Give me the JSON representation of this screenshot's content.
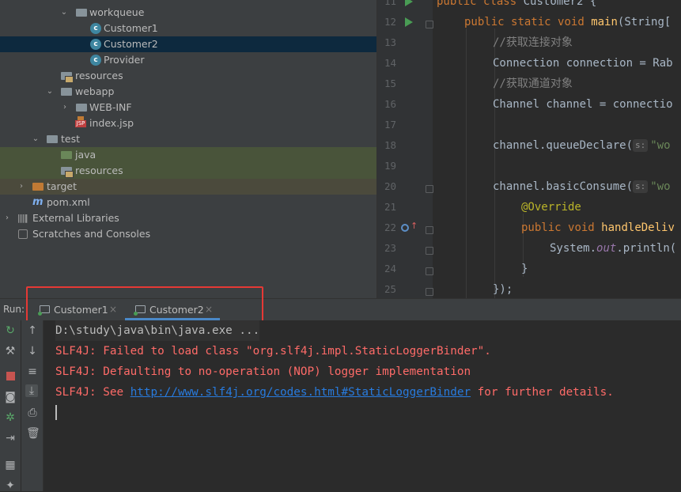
{
  "tree": {
    "items": [
      {
        "label": "workqueue",
        "kind": "package",
        "arrow": "open"
      },
      {
        "label": "Customer1",
        "kind": "class"
      },
      {
        "label": "Customer2",
        "kind": "class",
        "selected": true
      },
      {
        "label": "Provider",
        "kind": "class"
      },
      {
        "label": "resources",
        "kind": "resources"
      },
      {
        "label": "webapp",
        "kind": "folder",
        "arrow": "open"
      },
      {
        "label": "WEB-INF",
        "kind": "folder",
        "arrow": "closed"
      },
      {
        "label": "index.jsp",
        "kind": "jsp"
      },
      {
        "label": "test",
        "kind": "folder",
        "arrow": "open"
      },
      {
        "label": "java",
        "kind": "test-source"
      },
      {
        "label": "resources",
        "kind": "test-resources"
      },
      {
        "label": "target",
        "kind": "excluded",
        "arrow": "closed"
      },
      {
        "label": "pom.xml",
        "kind": "maven"
      },
      {
        "label": "External Libraries",
        "kind": "libraries",
        "arrow": "closed"
      },
      {
        "label": "Scratches and Consoles",
        "kind": "scratches"
      }
    ]
  },
  "editor": {
    "line_numbers": [
      "11",
      "12",
      "13",
      "14",
      "15",
      "16",
      "17",
      "18",
      "19",
      "20",
      "21",
      "22",
      "23",
      "24",
      "25"
    ],
    "lines": {
      "l11": {
        "kw1": "public",
        "kw2": "class",
        "name": "Customer2 {"
      },
      "l12": {
        "kw1": "public",
        "kw2": "static",
        "kw3": "void",
        "fn": "main",
        "rest": "(String["
      },
      "l13": "//获取连接对象",
      "l14": "Connection connection = Rab",
      "l15": "//获取通道对象",
      "l16": "Channel channel = connectio",
      "l18": {
        "pre": "channel.queueDeclare(",
        "hint": "s:",
        "str": "\"wo"
      },
      "l20": {
        "pre": "channel.basicConsume(",
        "hint": "s:",
        "str": "\"wo"
      },
      "l21": "@Override",
      "l22": {
        "kw1": "public",
        "kw2": "void",
        "fn": "handleDeliv"
      },
      "l23": {
        "pre": "System.",
        "static": "out",
        "post": ".println("
      },
      "l24": "}",
      "l25": "});"
    }
  },
  "run": {
    "label": "Run:",
    "tabs": [
      {
        "label": "Customer1",
        "close": "×",
        "active": false
      },
      {
        "label": "Customer2",
        "close": "×",
        "active": true
      }
    ],
    "accent": "#4a88c7",
    "highlight_color": "#e53935"
  },
  "console": {
    "command": "D:\\study\\java\\bin\\java.exe ...",
    "lines": [
      "SLF4J: Failed to load class \"org.slf4j.impl.StaticLoggerBinder\".",
      "SLF4J: Defaulting to no-operation (NOP) logger implementation"
    ],
    "see_prefix": "SLF4J: See ",
    "see_link": "http://www.slf4j.org/codes.html#StaticLoggerBinder",
    "see_suffix": " for further details.",
    "error_color": "#ff6b68"
  }
}
